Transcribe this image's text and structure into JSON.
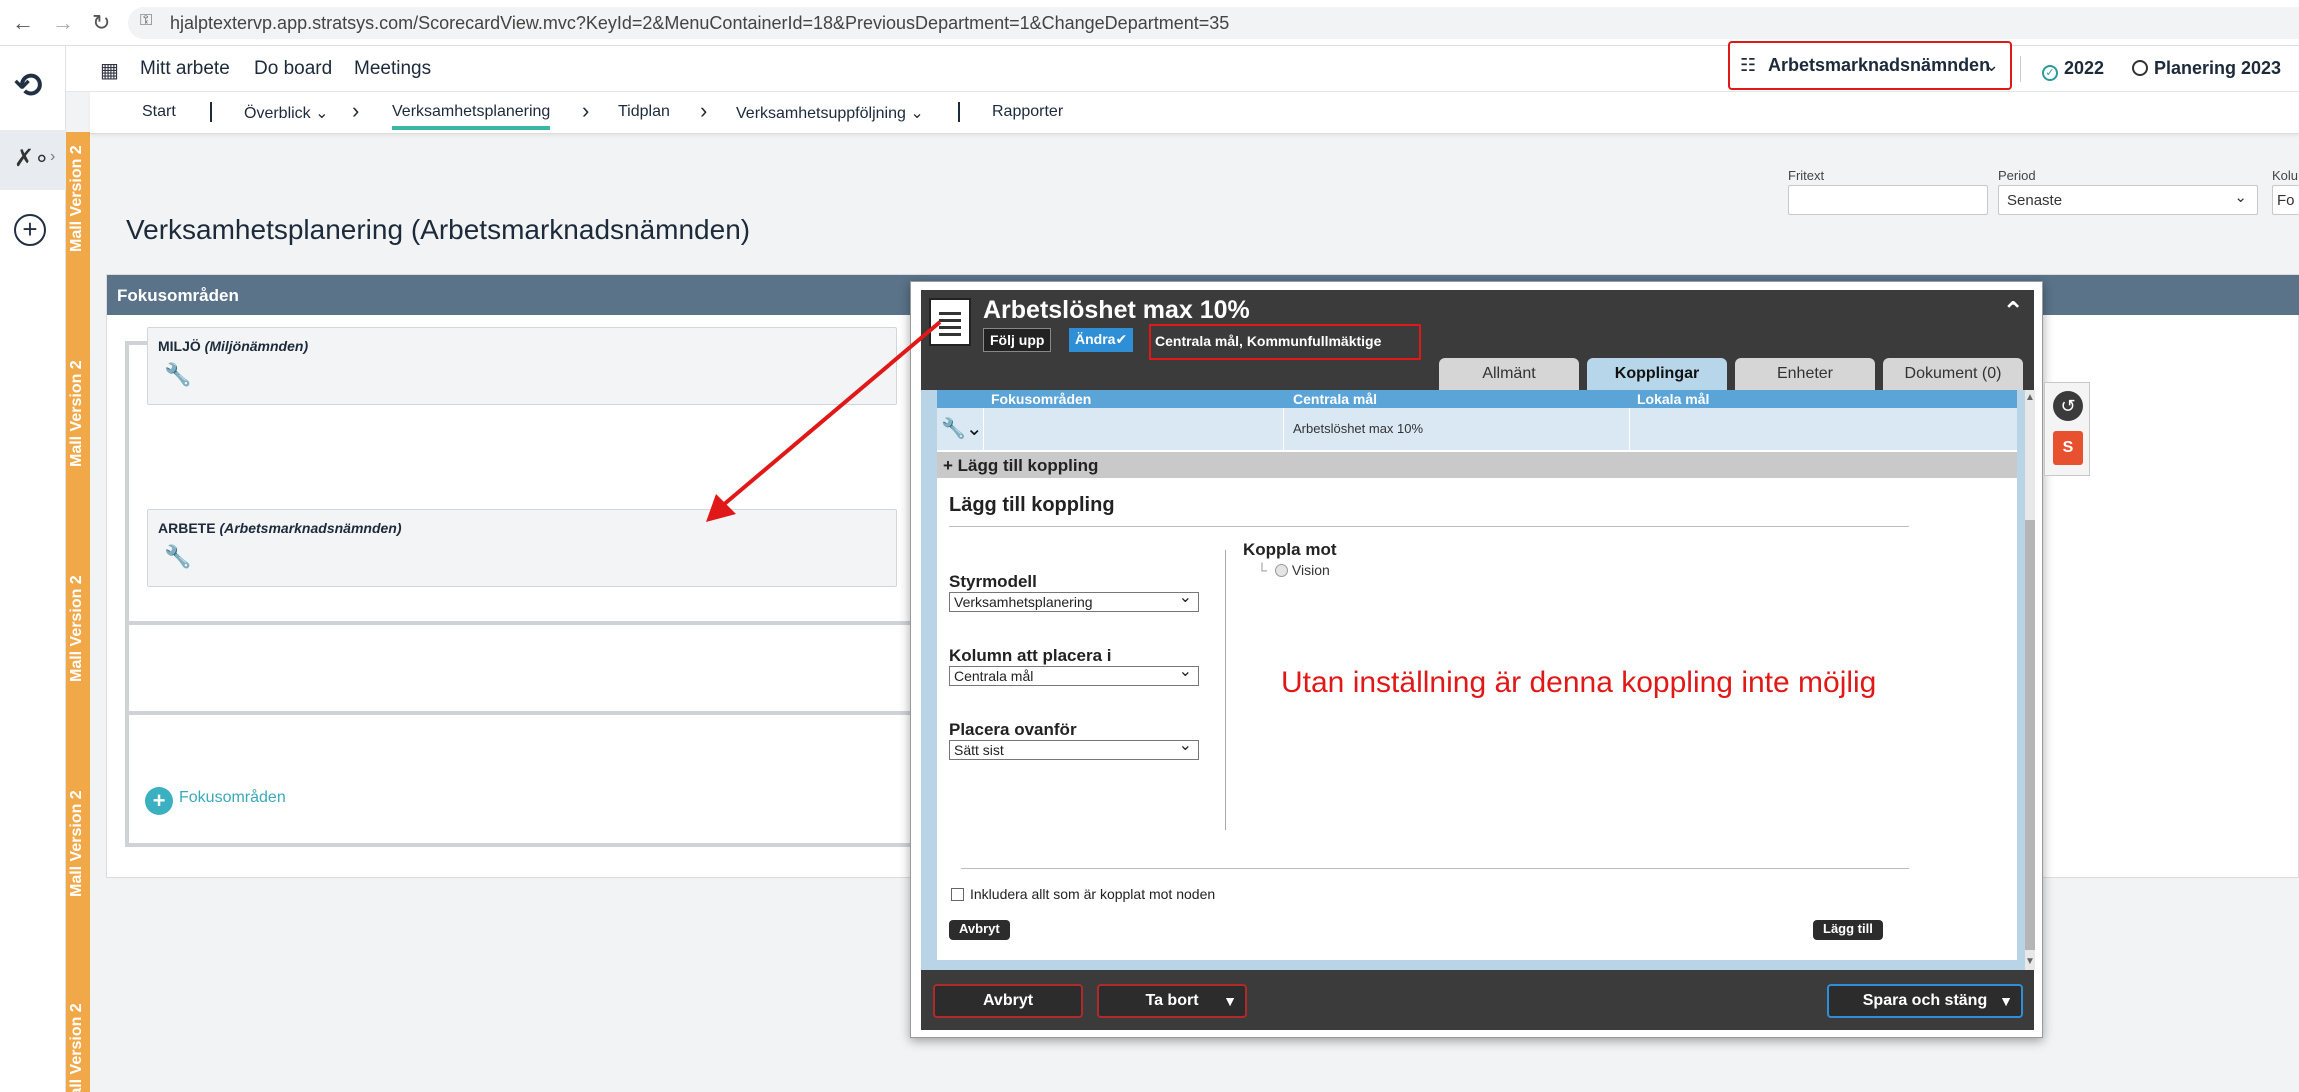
{
  "browser": {
    "url": "hjalptextervp.app.stratsys.com/ScorecardView.mvc?KeyId=2&MenuContainerId=18&PreviousDepartment=1&ChangeDepartment=35"
  },
  "header": {
    "links": [
      "Mitt arbete",
      "Do board",
      "Meetings"
    ],
    "department": "Arbetsmarknadsnämnden",
    "year": "2022",
    "planning": "Planering 2023"
  },
  "subnav": {
    "items": [
      "Start",
      "Överblick",
      "Verksamhetsplanering",
      "Tidplan",
      "Verksamhetsuppföljning",
      "Rapporter"
    ]
  },
  "strip": {
    "label": "Mall Version 2"
  },
  "filters": {
    "fritext_label": "Fritext",
    "period_label": "Period",
    "period_value": "Senaste",
    "kol_label": "Kolu",
    "kol_value": "Fo"
  },
  "page": {
    "title": "Verksamhetsplanering (Arbetsmarknadsnämnden)",
    "panel_title": "Fokusområden",
    "cards": [
      {
        "name": "MILJÖ",
        "owner": "(Miljönämnden)"
      },
      {
        "name": "ARBETE",
        "owner": "(Arbetsmarknadsnämnden)"
      }
    ],
    "add_label": "Fokusområden"
  },
  "modal": {
    "title": "Arbetslöshet max 10%",
    "folj_upp": "Följ upp",
    "andra": "Ändra",
    "breadcrumb": "Centrala mål, Kommunfullmäktige",
    "tabs": [
      "Allmänt",
      "Kopplingar",
      "Enheter",
      "Dokument (0)"
    ],
    "active_tab": "Kopplingar",
    "table": {
      "headers": [
        "Fokusområden",
        "Centrala mål",
        "Lokala mål"
      ],
      "row_value": "Arbetslöshet max 10%"
    },
    "add_bar": "+ Lägg till koppling",
    "section_title": "Lägg till koppling",
    "styrmodell_label": "Styrmodell",
    "styrmodell_value": "Verksamhetsplanering",
    "kolumn_label": "Kolumn att placera i",
    "kolumn_value": "Centrala mål",
    "placera_label": "Placera ovanför",
    "placera_value": "Sätt sist",
    "koppla_mot": "Koppla mot",
    "vision": "Vision",
    "annotation": "Utan inställning är denna koppling inte möjlig",
    "include_label": "Inkludera allt som är kopplat mot noden",
    "avbryt_small": "Avbryt",
    "lagg_till": "Lägg till",
    "footer": {
      "avbryt": "Avbryt",
      "ta_bort": "Ta bort",
      "spara": "Spara och stäng"
    }
  },
  "colors": {
    "accent_teal": "#3ab6a4",
    "panel_header": "#5a7389",
    "annotation_red": "#e01818",
    "strip_orange": "#f0a848"
  }
}
